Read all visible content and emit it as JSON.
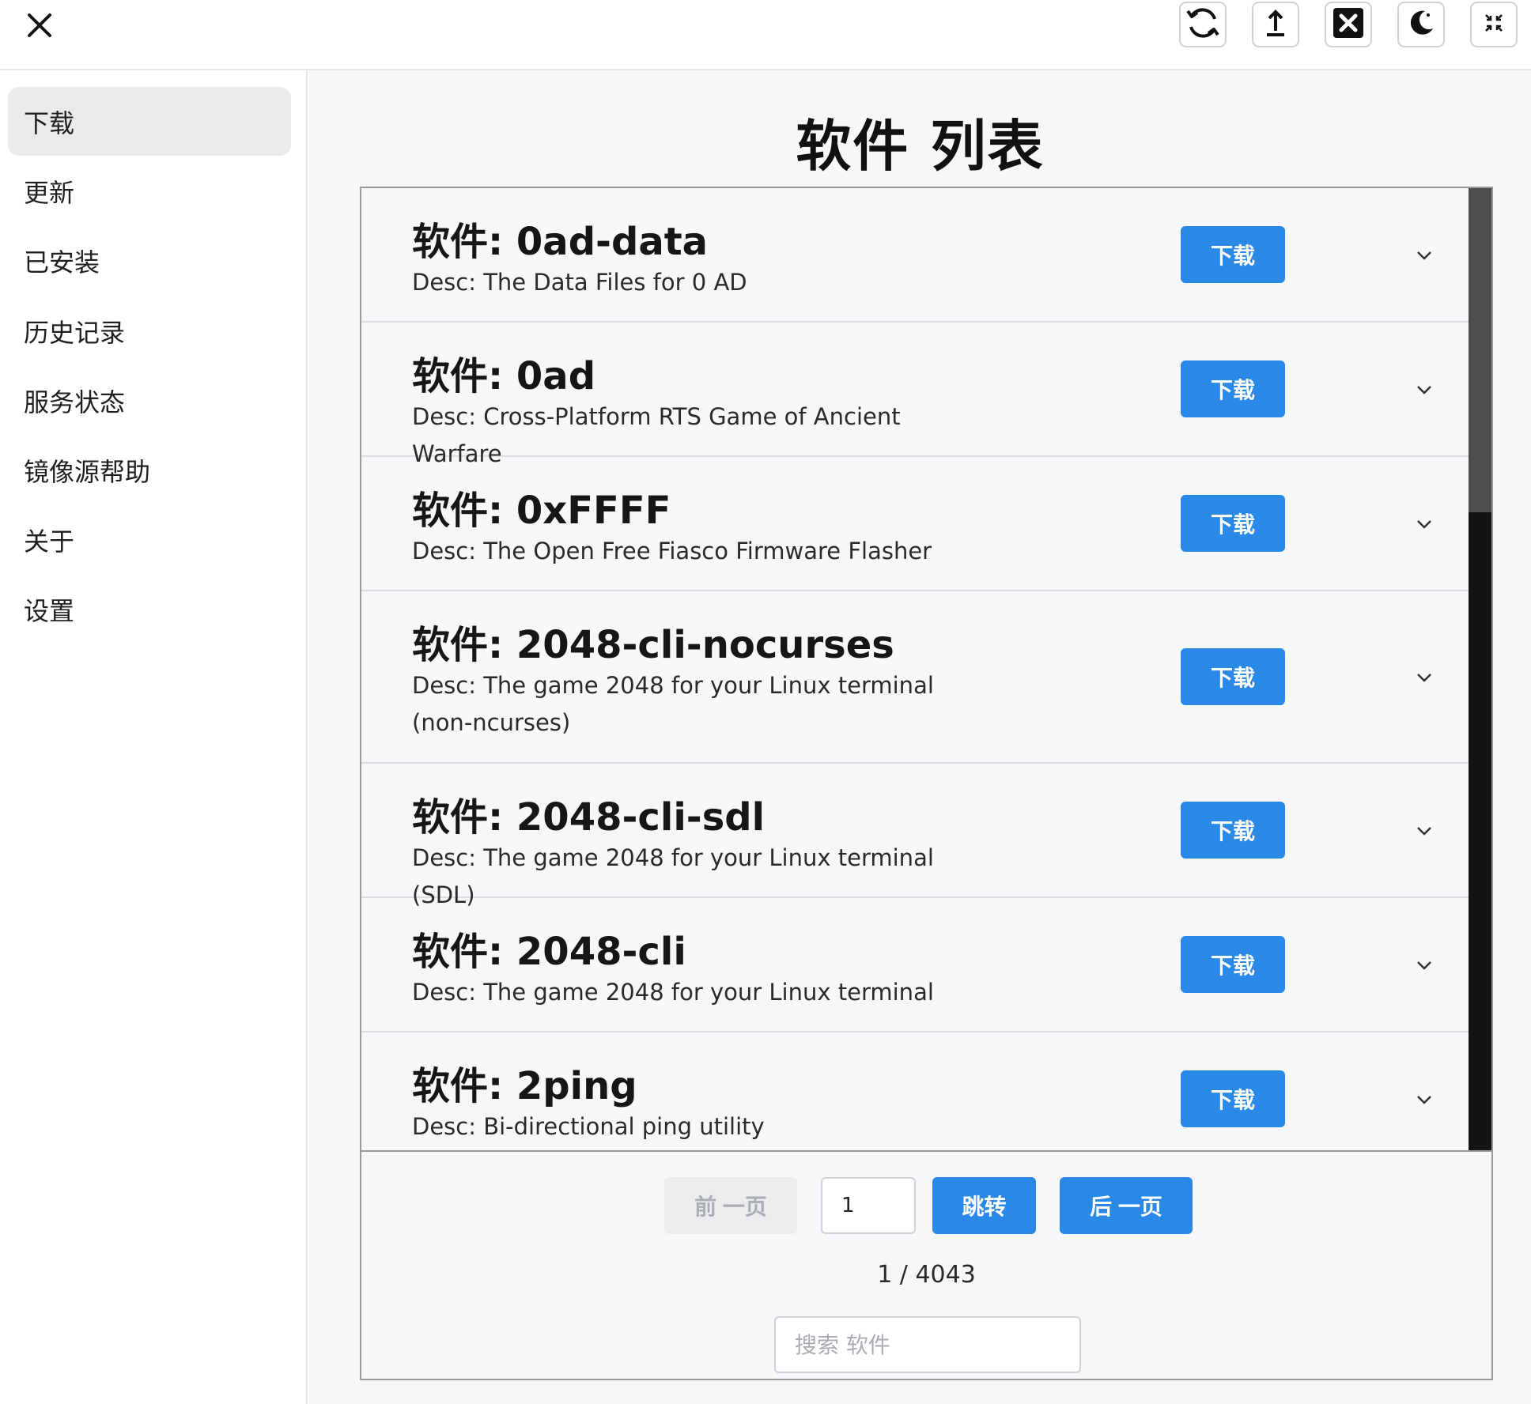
{
  "nav": {
    "items": [
      {
        "label": "下载",
        "active": true
      },
      {
        "label": "更新"
      },
      {
        "label": "已安装"
      },
      {
        "label": "历史记录"
      },
      {
        "label": "服务状态"
      },
      {
        "label": "镜像源帮助"
      },
      {
        "label": "关于"
      },
      {
        "label": "设置"
      }
    ]
  },
  "toolbar": {
    "icons": [
      "close-icon",
      "refresh-icon",
      "upload-icon",
      "close-square-icon",
      "moon-icon",
      "shrink-icon"
    ]
  },
  "main": {
    "title": "软件 列表",
    "packages": [
      {
        "name": "软件: 0ad-data",
        "desc": "Desc: The Data Files for 0 AD",
        "button": "下载"
      },
      {
        "name": "软件: 0ad",
        "desc": "Desc: Cross-Platform RTS Game of Ancient Warfare",
        "button": "下载"
      },
      {
        "name": "软件: 0xFFFF",
        "desc": "Desc: The Open Free Fiasco Firmware Flasher",
        "button": "下载"
      },
      {
        "name": "软件: 2048-cli-nocurses",
        "desc": "Desc: The game 2048 for your Linux terminal (non-ncurses)",
        "button": "下载"
      },
      {
        "name": "软件: 2048-cli-sdl",
        "desc": "Desc: The game 2048 for your Linux terminal (SDL)",
        "button": "下载"
      },
      {
        "name": "软件: 2048-cli",
        "desc": "Desc: The game 2048 for your Linux terminal",
        "button": "下载"
      },
      {
        "name": "软件: 2ping",
        "desc": "Desc: Bi-directional ping utility",
        "button": "下载"
      }
    ],
    "pager": {
      "prev": "前 一页",
      "page_value": "1",
      "jump": "跳转",
      "next": "后 一页",
      "count": "1 / 4043",
      "search_placeholder": "搜索 软件"
    }
  },
  "colors": {
    "accent": "#2a88e6",
    "nav_active_bg": "#e9eaec",
    "main_bg": "#f6f7f9",
    "scrollbar": "#141414"
  }
}
